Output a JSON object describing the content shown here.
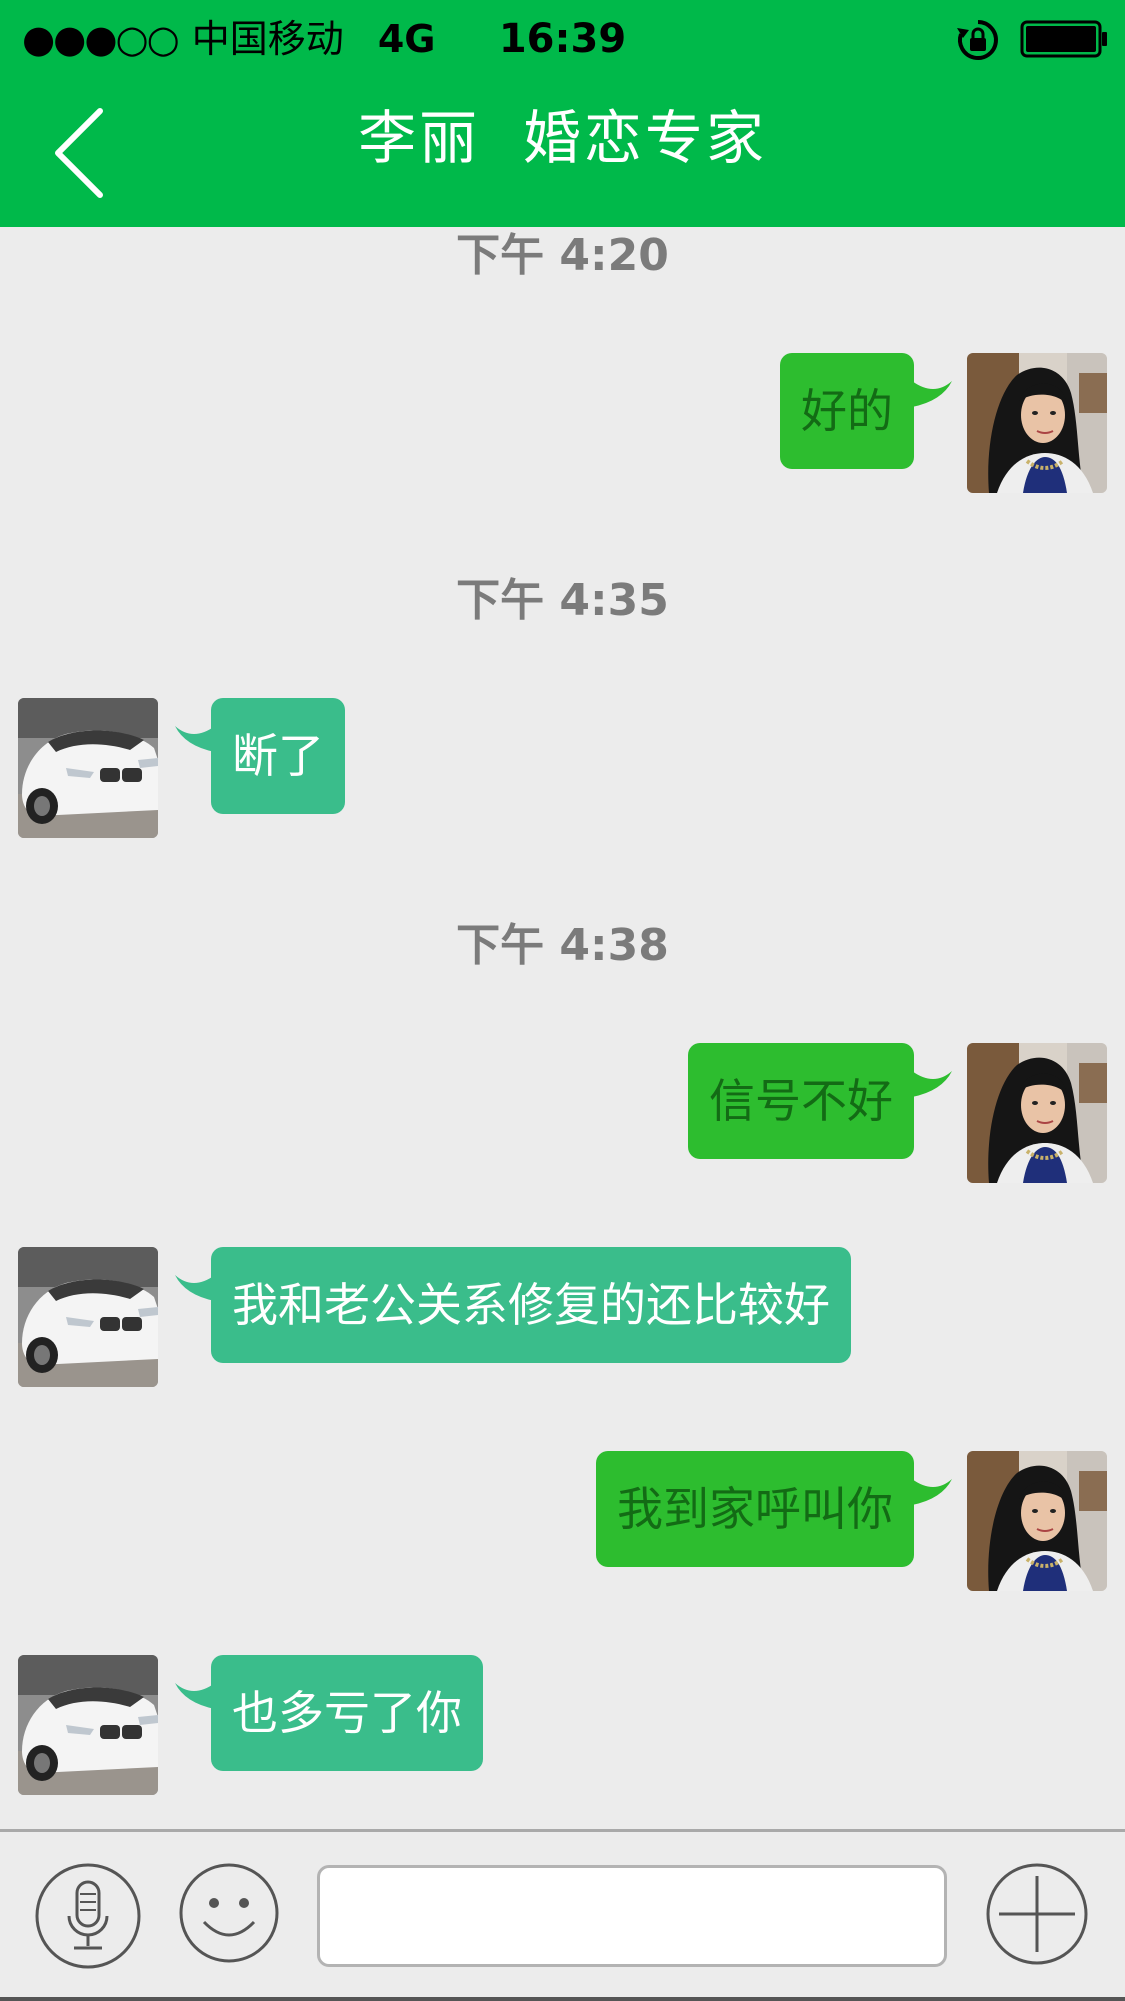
{
  "status_bar": {
    "signal": "●●●○○",
    "carrier": "中国移动",
    "network": "4G",
    "time": "16:39"
  },
  "nav": {
    "title": "李丽  婚恋专家"
  },
  "colors": {
    "nav_green": "#00b94a",
    "sent_bubble": "#2dbd2f",
    "received_bubble": "#3abd8b",
    "background": "#ececec"
  },
  "messages": [
    {
      "type": "time",
      "text": "下午 4:20"
    },
    {
      "type": "sent",
      "text": "好的"
    },
    {
      "type": "time",
      "text": "下午 4:35"
    },
    {
      "type": "received",
      "text": "断了"
    },
    {
      "type": "time",
      "text": "下午 4:38"
    },
    {
      "type": "sent",
      "text": "信号不好"
    },
    {
      "type": "received",
      "text": "我和老公关系修复的还比较好"
    },
    {
      "type": "sent",
      "text": "我到家呼叫你"
    },
    {
      "type": "received",
      "text": "也多亏了你"
    }
  ],
  "input_bar": {
    "voice_icon": "microphone-icon",
    "emoji_icon": "smiley-icon",
    "add_icon": "plus-icon",
    "message_value": ""
  }
}
